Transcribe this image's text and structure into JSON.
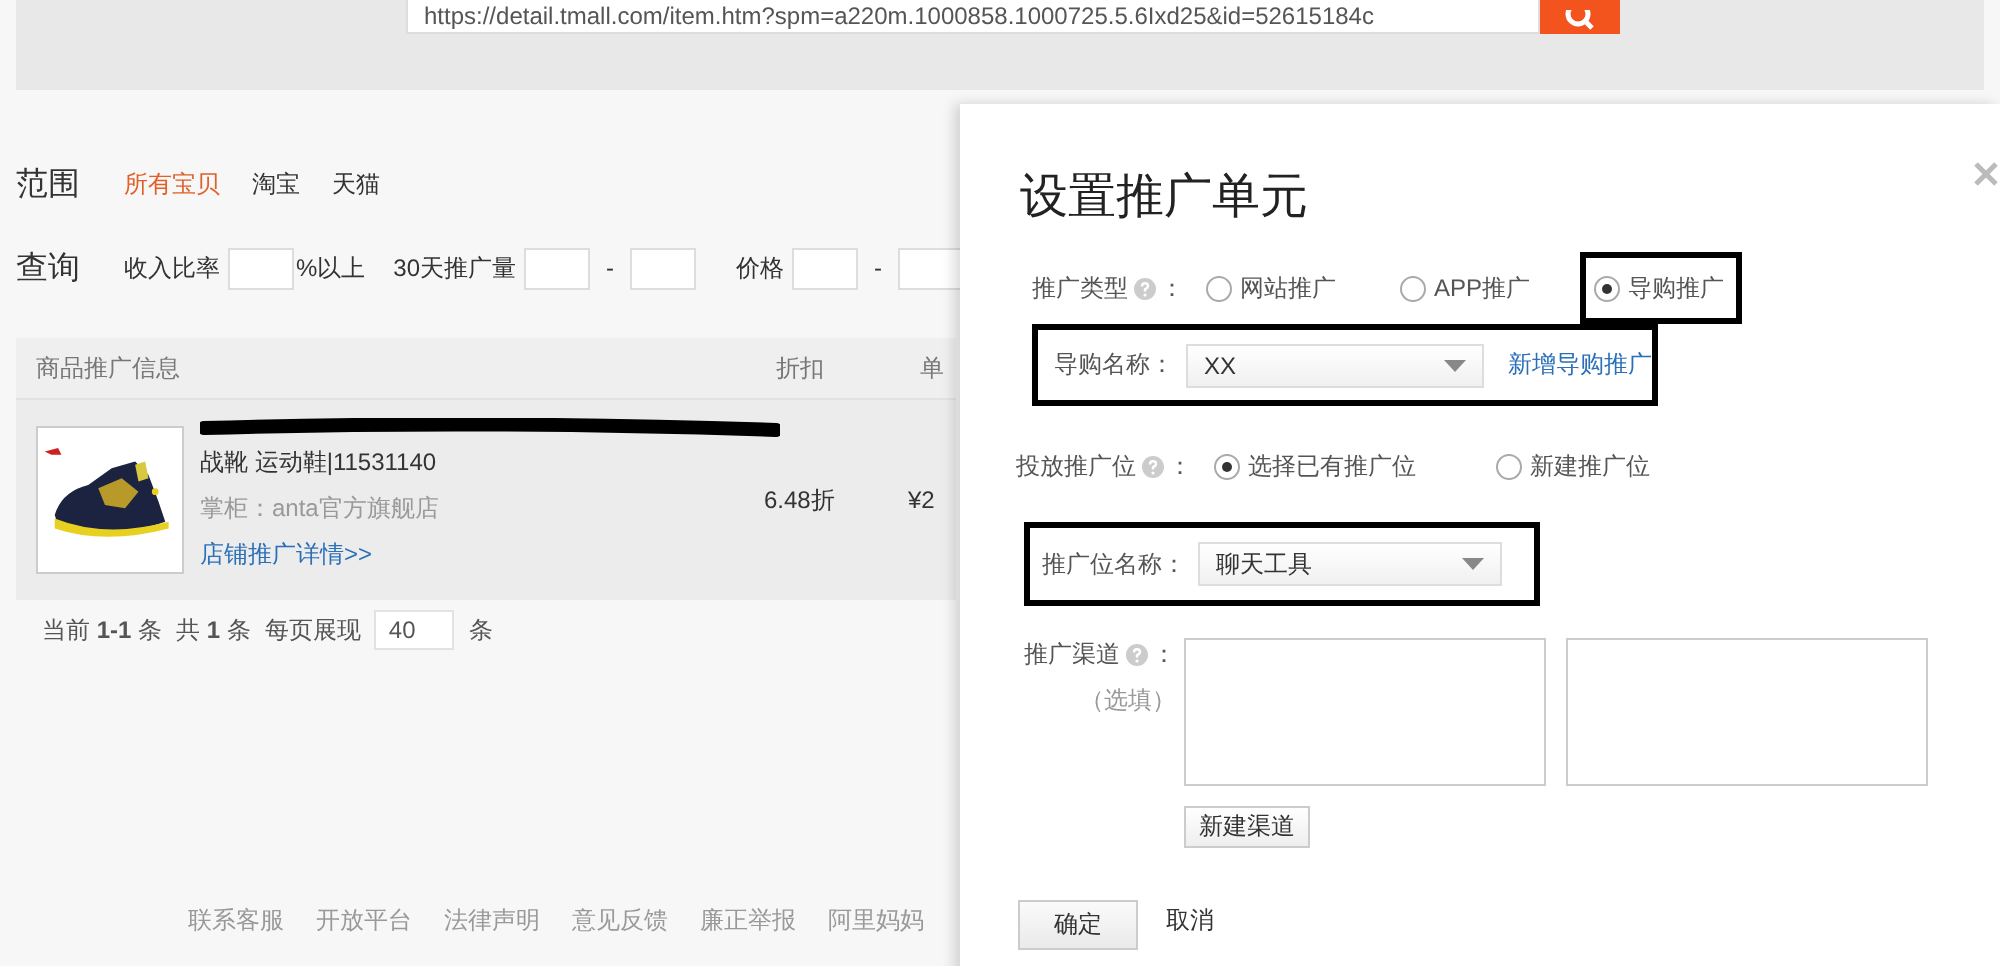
{
  "browser": {
    "url": "https://detail.tmall.com/item.htm?spm=a220m.1000858.1000725.5.6Ixd25&id=52615184c"
  },
  "scope": {
    "label": "范围",
    "options": [
      {
        "label": "所有宝贝",
        "selected": true
      },
      {
        "label": "淘宝",
        "selected": false
      },
      {
        "label": "天猫",
        "selected": false
      }
    ]
  },
  "query": {
    "label": "查询",
    "filters": [
      {
        "label": "收入比率",
        "kind": "single",
        "suffix": "%以上"
      },
      {
        "label": "30天推广量",
        "kind": "range",
        "separator": "-"
      },
      {
        "label": "价格",
        "kind": "range",
        "separator": "-"
      }
    ]
  },
  "table": {
    "columns": [
      "商品推广信息",
      "折扣",
      "单"
    ],
    "rows": [
      {
        "kind": "picture",
        "subtitle": "战靴 运动鞋|11531140",
        "shop": "掌柜：anta官方旗舰店",
        "link": "店铺推广详情>>",
        "discount": "6.48折",
        "price": "¥2"
      }
    ]
  },
  "pagination": {
    "parts": [
      "当前 **1-1** 条",
      "共 **1** 条",
      "每页展现"
    ],
    "per_page": "40",
    "unit": "条"
  },
  "footer_links": [
    "联系客服",
    "开放平台",
    "法律声明",
    "意见反馈",
    "廉正举报",
    "阿里妈妈"
  ],
  "dialog": {
    "title": "设置推广单元",
    "promo_type": {
      "label": "推广类型",
      "colon": "：",
      "options": [
        {
          "label": "网站推广",
          "selected": false,
          "highlighted": false
        },
        {
          "label": "APP推广",
          "selected": false,
          "highlighted": false
        },
        {
          "label": "导购推广",
          "selected": true,
          "highlighted": true
        }
      ]
    },
    "guide": {
      "label": "导购名称：",
      "value": "XX",
      "link": "新增导购推广",
      "highlighted": true
    },
    "placement": {
      "label": "投放推广位",
      "colon": "：",
      "options": [
        {
          "label": "选择已有推广位",
          "selected": true,
          "highlighted": false
        },
        {
          "label": "新建推广位",
          "selected": false,
          "highlighted": false
        }
      ]
    },
    "placement_name": {
      "label": "推广位名称：",
      "value": "聊天工具",
      "highlighted": true
    },
    "channel": {
      "label": "推广渠道",
      "colon": "：",
      "note": "（选填）",
      "button": "新建渠道"
    },
    "buttons": [
      {
        "label": "确定",
        "kind": "primary"
      },
      {
        "label": "取消",
        "kind": "link"
      }
    ]
  }
}
